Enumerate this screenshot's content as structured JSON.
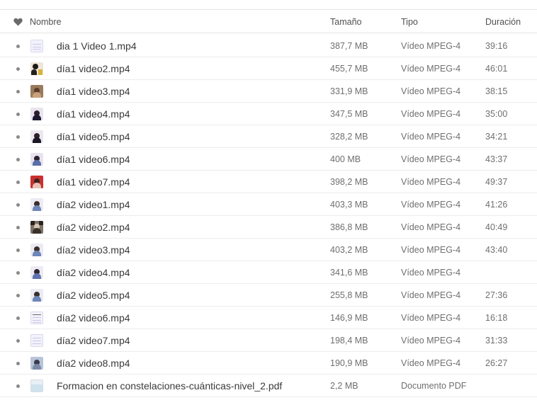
{
  "header": {
    "favorite_icon": "heart-icon",
    "name": "Nombre",
    "size": "Tamaño",
    "type": "Tipo",
    "duration": "Duración"
  },
  "rows": [
    {
      "name": "dia 1 Video 1.mp4",
      "size": "387,7 MB",
      "type": "Vídeo MPEG-4",
      "duration": "39:16",
      "thumb": "video-lines-thumbnail-icon"
    },
    {
      "name": "día1 video2.mp4",
      "size": "455,7 MB",
      "type": "Vídeo MPEG-4",
      "duration": "46:01",
      "thumb": "video-person-thumbnail-icon"
    },
    {
      "name": "día1 video3.mp4",
      "size": "331,9 MB",
      "type": "Vídeo MPEG-4",
      "duration": "38:15",
      "thumb": "video-person-thumbnail-icon"
    },
    {
      "name": "día1 video4.mp4",
      "size": "347,5 MB",
      "type": "Vídeo MPEG-4",
      "duration": "35:00",
      "thumb": "video-person-thumbnail-icon"
    },
    {
      "name": "día1 video5.mp4",
      "size": "328,2 MB",
      "type": "Vídeo MPEG-4",
      "duration": "34:21",
      "thumb": "video-person-thumbnail-icon"
    },
    {
      "name": "día1 video6.mp4",
      "size": "400 MB",
      "type": "Vídeo MPEG-4",
      "duration": "43:37",
      "thumb": "video-person-thumbnail-icon"
    },
    {
      "name": "día1 video7.mp4",
      "size": "398,2 MB",
      "type": "Vídeo MPEG-4",
      "duration": "49:37",
      "thumb": "video-person-thumbnail-icon"
    },
    {
      "name": "día2 video1.mp4",
      "size": "403,3 MB",
      "type": "Vídeo MPEG-4",
      "duration": "41:26",
      "thumb": "video-person-thumbnail-icon"
    },
    {
      "name": "día2 video2.mp4",
      "size": "386,8 MB",
      "type": "Vídeo MPEG-4",
      "duration": "40:49",
      "thumb": "video-person-thumbnail-icon"
    },
    {
      "name": "día2 video3.mp4",
      "size": "403,2 MB",
      "type": "Vídeo MPEG-4",
      "duration": "43:40",
      "thumb": "video-person-thumbnail-icon"
    },
    {
      "name": "día2 video4.mp4",
      "size": "341,6 MB",
      "type": "Vídeo MPEG-4",
      "duration": "",
      "thumb": "video-person-thumbnail-icon"
    },
    {
      "name": "día2 video5.mp4",
      "size": "255,8 MB",
      "type": "Vídeo MPEG-4",
      "duration": "27:36",
      "thumb": "video-person-thumbnail-icon"
    },
    {
      "name": "día2 video6.mp4",
      "size": "146,9 MB",
      "type": "Vídeo MPEG-4",
      "duration": "16:18",
      "thumb": "video-lines-thumbnail-icon"
    },
    {
      "name": "día2 video7.mp4",
      "size": "198,4 MB",
      "type": "Vídeo MPEG-4",
      "duration": "31:33",
      "thumb": "video-lines-thumbnail-icon"
    },
    {
      "name": "día2 video8.mp4",
      "size": "190,9 MB",
      "type": "Vídeo MPEG-4",
      "duration": "26:27",
      "thumb": "video-person-thumbnail-icon"
    },
    {
      "name": "Formacion en constelaciones-cuánticas-nivel_2.pdf",
      "size": "2,2 MB",
      "type": "Documento PDF",
      "duration": "",
      "thumb": "pdf-thumbnail-icon"
    }
  ],
  "colors": {
    "text_primary": "#3a3a3a",
    "text_secondary": "#6f6f6f",
    "divider": "#ececec",
    "bullet": "#8a8a8a"
  }
}
